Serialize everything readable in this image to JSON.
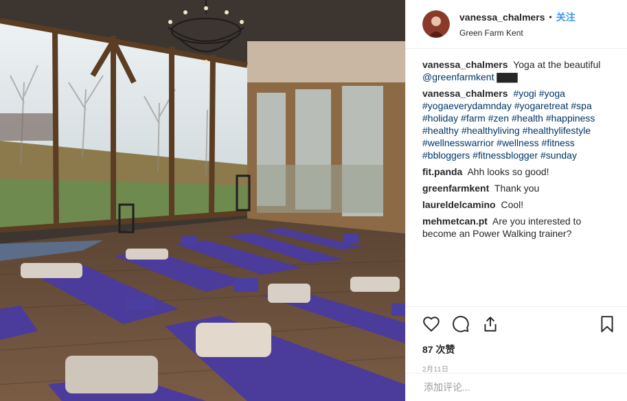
{
  "header": {
    "username": "vanessa_chalmers",
    "separator": "•",
    "follow_label": "关注",
    "location": "Green Farm Kent"
  },
  "caption": {
    "username": "vanessa_chalmers",
    "text": "Yoga at the beautiful",
    "mention": "@greenfarmkent",
    "trailing_symbols": "▇▇▇"
  },
  "hashtag_comment": {
    "username": "vanessa_chalmers",
    "tags": [
      "#yogi",
      "#yoga",
      "#yogaeverydamnday",
      "#yogaretreat",
      "#spa",
      "#holiday",
      "#farm",
      "#zen",
      "#health",
      "#happiness",
      "#healthy",
      "#healthyliving",
      "#healthylifestyle",
      "#wellnesswarrior",
      "#wellness",
      "#fitness",
      "#bbloggers",
      "#fitnessblogger",
      "#sunday"
    ]
  },
  "comments": [
    {
      "username": "fit.panda",
      "text": "Ahh looks so good!"
    },
    {
      "username": "greenfarmkent",
      "text": "Thank you"
    },
    {
      "username": "laureldelcamino",
      "text": "Cool!"
    },
    {
      "username": "mehmetcan.pt",
      "text": "Are you interested to become an Power Walking trainer?"
    }
  ],
  "actions": {
    "icons": [
      "heart-icon",
      "comment-icon",
      "share-icon",
      "bookmark-icon"
    ],
    "likes": "87 次赞",
    "date": "2月11日"
  },
  "add_comment": {
    "placeholder": "添加评论..."
  },
  "colors": {
    "link": "#003569",
    "follow": "#3897f0",
    "mat": "#4b3b9a",
    "floor": "#6a4f3a"
  }
}
